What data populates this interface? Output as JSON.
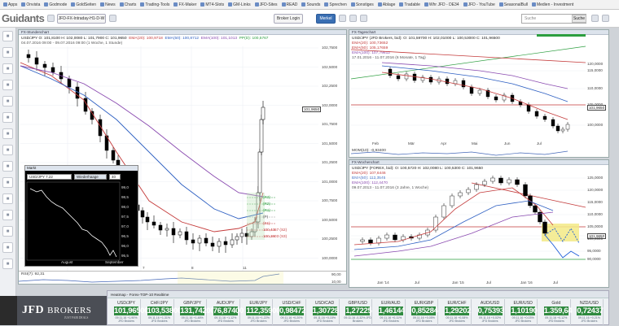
{
  "bookmarks": [
    "Apps",
    "Onvista",
    "Godmode",
    "GoldSeiten",
    "News",
    "Charts",
    "Trading-Tools",
    "FX-Maker",
    "MT4-Slots",
    "GM-Links",
    "JFD-Sites",
    "READ",
    "Sounds",
    "Sprechen",
    "Sonstiges",
    "Ablage",
    "Tradable",
    "Whr JFD - DE34",
    "JFD - YouTube",
    "SeasonalBull",
    "Medien - Investment"
  ],
  "app": {
    "logo": "Guidants",
    "tab_label": "JFD-FX-Intraday-H1-D-W",
    "btn1": "Broker Login",
    "btn2": "Merkel",
    "search_placeholder": "Suche",
    "search_button": "Suche"
  },
  "sidebar_icons": [
    "user-icon",
    "chart-icon",
    "grid-icon",
    "envelope-icon",
    "bell-icon",
    "star-icon",
    "doc-icon",
    "globe-icon",
    "cog-icon",
    "help-icon",
    "list-icon",
    "bookmark-icon",
    "news-icon",
    "user2-icon",
    "chat-icon"
  ],
  "left_chart": {
    "header": "FX-Stundenchart",
    "info1": "USD/JPY  O: 101,8100  H: 102,0080  L: 101,7900  C: 101,9650",
    "ma_labels": [
      "EMA(20): 100,9718",
      "EMA(50): 100,8712",
      "EMA(100): 101,1013",
      "PP(D): 100,5767"
    ],
    "info2": "04.07.2016 09:00 - 09.07.2016 09:00 (1 Woche, 1 Stunde)",
    "yticks": [
      "102,7500",
      "102,5000",
      "102,2500",
      "102,0000",
      "101,7500",
      "101,5000",
      "101,2500",
      "101,0000",
      "100,7500",
      "100,5000",
      "100,2500",
      "100,0000"
    ],
    "price_tag": "101,9650",
    "levels": [
      "(R3)",
      "(R2)",
      "(R1)",
      "(P)",
      "(S1)",
      "100,4357 (S2)",
      "100,3803 (S3)"
    ],
    "xticks": [
      "7",
      "8",
      "11"
    ],
    "rsi": "RSI(7): 92,31",
    "rsi_ticks": [
      "90,00",
      "10,00"
    ]
  },
  "indicator": {
    "header": "Markt",
    "selector": "USD/JPY 7.22",
    "label2": "Wiederhaage",
    "value2": "40",
    "ticks": [
      "99,0",
      "98,5",
      "98,0",
      "97,5",
      "97,0",
      "96,5",
      "96,0",
      "95,5"
    ],
    "xlabels": [
      "August",
      "September"
    ]
  },
  "daily_chart": {
    "header": "FX-Tageschart",
    "info1": "USD/JPY (JFD Brokers, bid): O: 101,59700  H: 102,01000  L: 100,53000  C: 101,96500",
    "ma_labels": [
      "EMA(20): 100,73652",
      "EMA(50): 105,17659",
      "EMA(100): 107,79612"
    ],
    "info2": "17.01.2016 - 11.07.2016 (6 Monate, 1 Tag)",
    "yticks": [
      "120,0000",
      "115,0000",
      "110,0000",
      "105,0000",
      "101,9650",
      "100,0000"
    ],
    "xticks": [
      "Feb",
      "Mär",
      "Apr",
      "Mai",
      "Jun",
      "Jul"
    ],
    "osc": "MOM(10): -0,93400"
  },
  "weekly_chart": {
    "header": "FX-Wochenchart",
    "info1": "USD/JPY (FOREX, bid): O: 100,5720  H: 102,0080  L: 100,5300  C: 101,9650",
    "ma_labels": [
      "EMA(20): 107,6446",
      "EMA(50): 112,3545",
      "EMA(100): 112,4470"
    ],
    "info2": "09.07.2013 - 11.07.2016 (3 Jahre, 1 Woche)",
    "yticks": [
      "125,0000",
      "120,0000",
      "115,0000",
      "110,0000",
      "105,0000",
      "101,9650",
      "100,0000",
      "95,0000",
      "90,0000"
    ],
    "xticks": [
      "Jan '14",
      "Jul",
      "Jan '15",
      "Jul",
      "Jan '16",
      "Jul"
    ]
  },
  "ticker": {
    "header": "Heatmap - Forex-TOP-10 Realtime",
    "tiles": [
      {
        "sym": "USD/JPY",
        "val": "101,96500",
        "ch": "09.11.16  +1,90%  JFD Brokers"
      },
      {
        "sym": "CHF/JPY",
        "val": "103,53800",
        "ch": "09.11.16  +1,31%  JFD Brokers"
      },
      {
        "sym": "GBP/JPY",
        "val": "131,74200",
        "ch": "09.11.16  +1,48%  JFD Brokers"
      },
      {
        "sym": "AUD/JPY",
        "val": "76,87400",
        "ch": "09.11.16  +1,12%  JFD Brokers"
      },
      {
        "sym": "EUR/JPY",
        "val": "112,35900",
        "ch": "09.11.16  +1,22%  JFD Brokers"
      },
      {
        "sym": "USD/CHF",
        "val": "0,98472",
        "ch": "09.11.16  +0,20%  JFD Brokers"
      },
      {
        "sym": "USD/CAD",
        "val": "1,30728",
        "ch": "09.11.16  +0,15%  JFD Brokers"
      },
      {
        "sym": "GBP/USD",
        "val": "1,27225",
        "ch": "09.11.16  -0,32%  JFD Brokers"
      },
      {
        "sym": "EUR/AUD",
        "val": "1,46144",
        "ch": "09.11.16  +0,11%  JFD Brokers"
      },
      {
        "sym": "EUR/GBP",
        "val": "0,85284",
        "ch": "09.11.16  +0,05%  JFD Brokers"
      },
      {
        "sym": "EUR/CHF",
        "val": "1,29202",
        "ch": "09.11.16  +0,08%  JFD Brokers"
      },
      {
        "sym": "AUD/USD",
        "val": "0,75393",
        "ch": "09.11.16  +0,02%  JFD Brokers"
      },
      {
        "sym": "EUR/USD",
        "val": "1,10190",
        "ch": "09.11.16  +0,03%  JFD Brokers"
      },
      {
        "sym": "Gold",
        "val": "1.359,64",
        "ch": "09.11.16  +0,12%  JFD Brokers"
      },
      {
        "sym": "NZD/USD",
        "val": "0,72437",
        "ch": "09.11.16  +0,21%  JFD Brokers"
      }
    ]
  },
  "brand": {
    "name1": "JFD",
    "name2": "BROKERS",
    "tagline": "JUST FAIR DEALS"
  },
  "colors": {
    "up": "#2f8a3f",
    "accent": "#3a6fb3",
    "candle": "#000000",
    "ema_red": "#c43a3a",
    "ema_blue": "#2d5fc2",
    "ema_purple": "#8a4ab0",
    "pivot_green": "#2c9e3f",
    "forecast": "#1a5bd8",
    "zone": "#f3ea86"
  }
}
